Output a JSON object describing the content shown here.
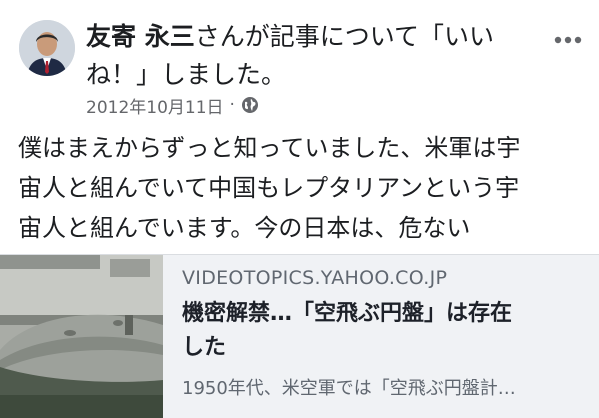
{
  "post": {
    "author": "友寄 永三",
    "action": "さんが記事について「いいね！」しました。",
    "timestamp": "2012年10月11日",
    "separator": "·",
    "privacy_icon": "globe-icon",
    "more_icon": "more-options-icon",
    "body_lines": [
      "僕はまえからずっと知っていました、米軍は宇",
      "宙人と組んでいて中国もレプタリアンという宇",
      "宙人と組んでいます。今の日本は、危ない"
    ]
  },
  "link_preview": {
    "domain": "VIDEOTOPICS.YAHOO.CO.JP",
    "title_lines": [
      "機密解禁…「空飛ぶ円盤」は存在",
      "した"
    ],
    "description": "1950年代、米空軍では「空飛ぶ円盤計…"
  },
  "colors": {
    "text": "#1c1e21",
    "meta": "#65676b",
    "card_bg": "#f0f2f5"
  }
}
